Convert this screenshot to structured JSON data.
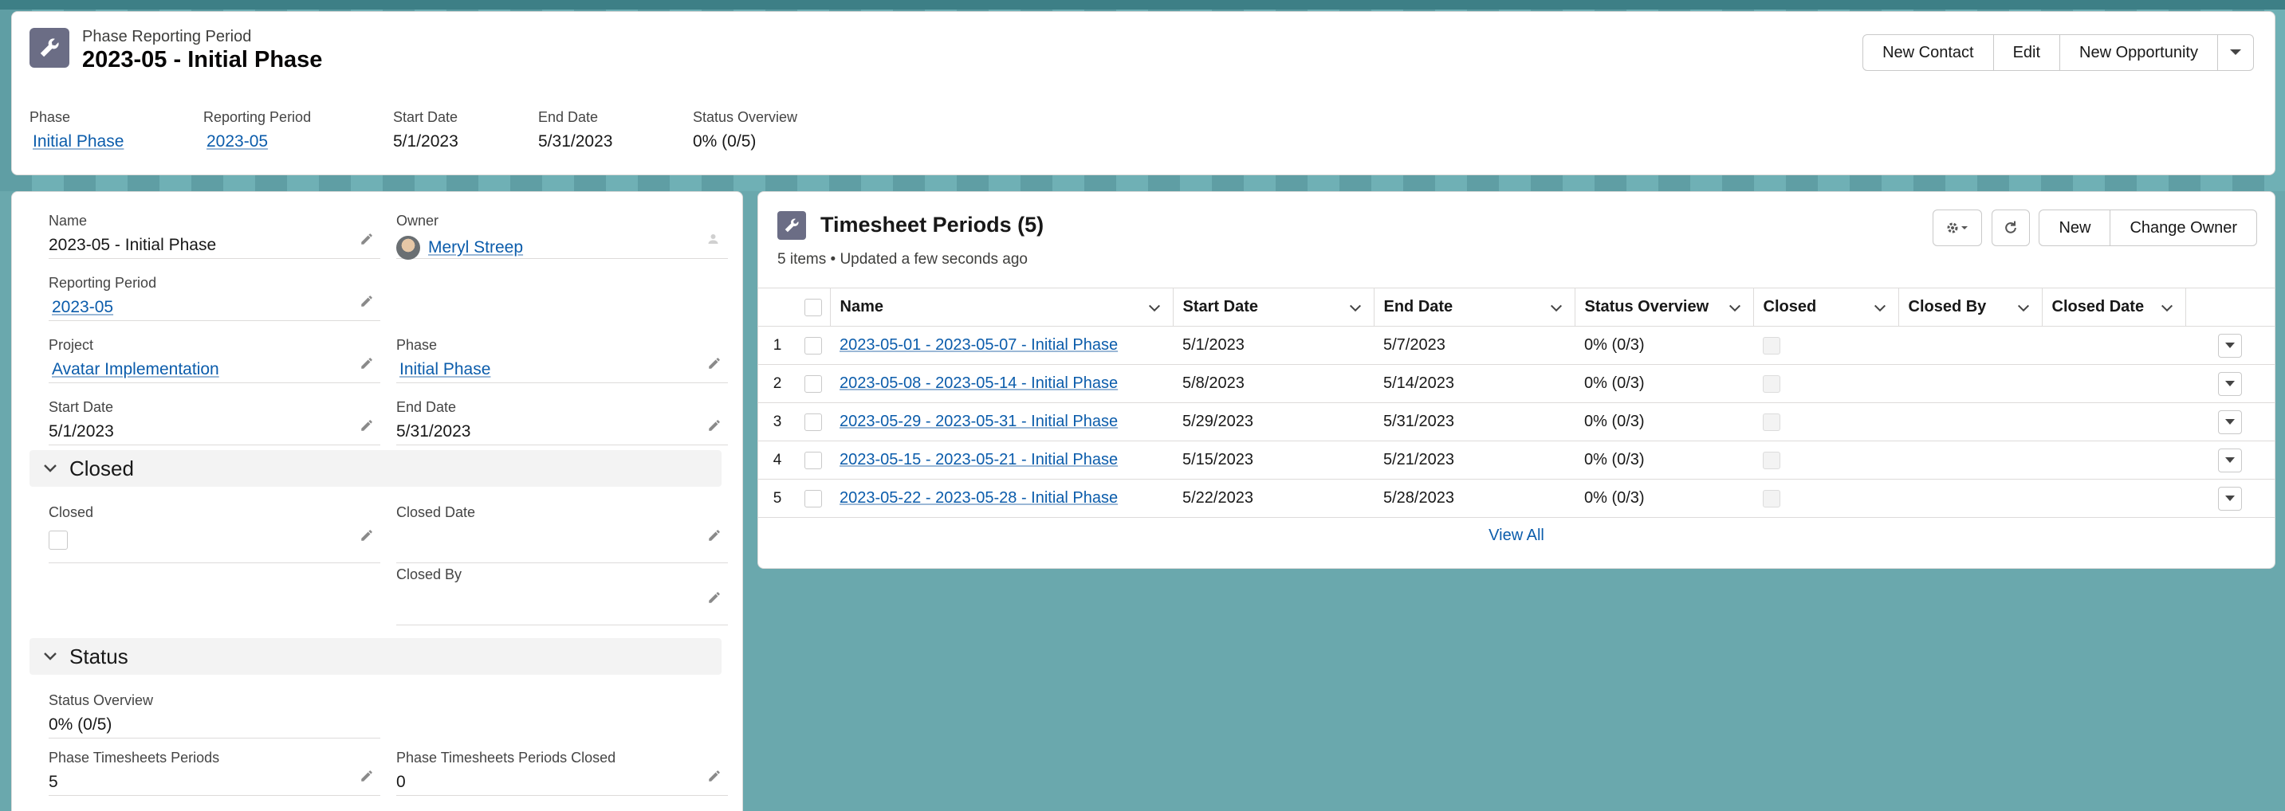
{
  "header": {
    "eyebrow": "Phase Reporting Period",
    "title": "2023-05 - Initial Phase",
    "buttons": [
      "New Contact",
      "Edit",
      "New Opportunity"
    ],
    "fields": [
      {
        "label": "Phase",
        "value": "Initial Phase",
        "link": true
      },
      {
        "label": "Reporting Period",
        "value": "2023-05",
        "link": true
      },
      {
        "label": "Start Date",
        "value": "5/1/2023",
        "link": false
      },
      {
        "label": "End Date",
        "value": "5/31/2023",
        "link": false
      },
      {
        "label": "Status Overview",
        "value": "0% (0/5)",
        "link": false
      }
    ]
  },
  "details": {
    "name_label": "Name",
    "name_value": "2023-05 - Initial Phase",
    "owner_label": "Owner",
    "owner_value": "Meryl Streep",
    "reporting_period_label": "Reporting Period",
    "reporting_period_value": "2023-05",
    "project_label": "Project",
    "project_value": "Avatar Implementation",
    "phase_label": "Phase",
    "phase_value": "Initial Phase",
    "start_date_label": "Start Date",
    "start_date_value": "5/1/2023",
    "end_date_label": "End Date",
    "end_date_value": "5/31/2023"
  },
  "closed_section": {
    "title": "Closed",
    "closed_label": "Closed",
    "closed_date_label": "Closed Date",
    "closed_by_label": "Closed By"
  },
  "status_section": {
    "title": "Status",
    "status_overview_label": "Status Overview",
    "status_overview_value": "0% (0/5)",
    "periods_label": "Phase Timesheets Periods",
    "periods_value": "5",
    "periods_closed_label": "Phase Timesheets Periods Closed",
    "periods_closed_value": "0"
  },
  "related": {
    "title": "Timesheet Periods (5)",
    "subtitle": "5 items • Updated a few seconds ago",
    "buttons": [
      "New",
      "Change Owner"
    ],
    "columns": [
      "Name",
      "Start Date",
      "End Date",
      "Status Overview",
      "Closed",
      "Closed By",
      "Closed Date"
    ],
    "rows": [
      {
        "num": "1",
        "name": "2023-05-01 - 2023-05-07 - Initial Phase",
        "start": "5/1/2023",
        "end": "5/7/2023",
        "status": "0% (0/3)"
      },
      {
        "num": "2",
        "name": "2023-05-08 - 2023-05-14 - Initial Phase",
        "start": "5/8/2023",
        "end": "5/14/2023",
        "status": "0% (0/3)"
      },
      {
        "num": "3",
        "name": "2023-05-29 - 2023-05-31 - Initial Phase",
        "start": "5/29/2023",
        "end": "5/31/2023",
        "status": "0% (0/3)"
      },
      {
        "num": "4",
        "name": "2023-05-15 - 2023-05-21 - Initial Phase",
        "start": "5/15/2023",
        "end": "5/21/2023",
        "status": "0% (0/3)"
      },
      {
        "num": "5",
        "name": "2023-05-22 - 2023-05-28 - Initial Phase",
        "start": "5/22/2023",
        "end": "5/28/2023",
        "status": "0% (0/3)"
      }
    ],
    "view_all": "View All"
  },
  "icons": {
    "record_icon": "wrench-icon",
    "edit_icon": "pencil-icon",
    "settings_icon": "gear-icon",
    "refresh_icon": "refresh-icon"
  }
}
